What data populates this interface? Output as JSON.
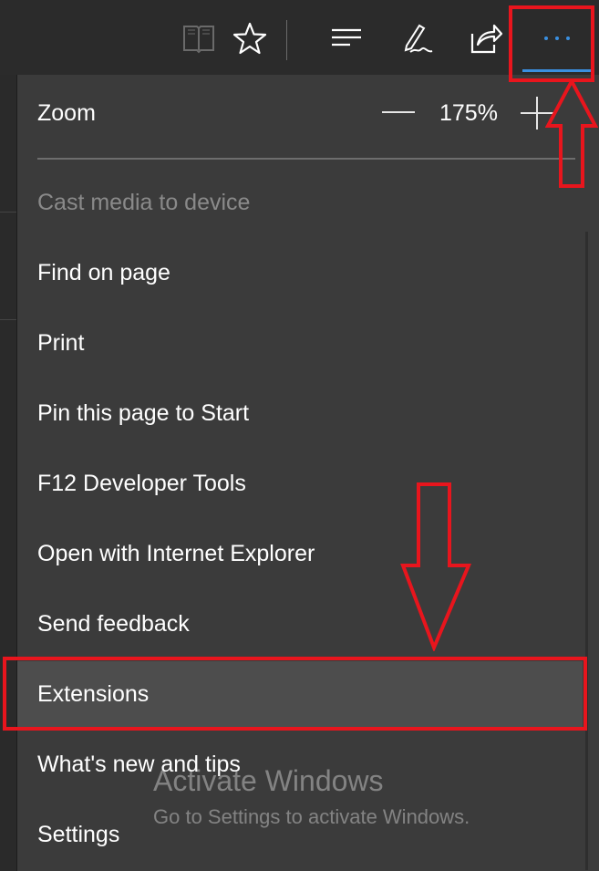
{
  "toolbar": {
    "icons": [
      "reading-view-icon",
      "favorite-star-icon",
      "hub-icon",
      "web-note-icon",
      "share-icon",
      "more-icon"
    ],
    "accent": "#3a8fe0"
  },
  "menu": {
    "zoom": {
      "label": "Zoom",
      "value": "175%"
    },
    "items": [
      {
        "label": "Cast media to device",
        "enabled": false
      },
      {
        "label": "Find on page",
        "enabled": true
      },
      {
        "label": "Print",
        "enabled": true
      },
      {
        "label": "Pin this page to Start",
        "enabled": true
      },
      {
        "label": "F12 Developer Tools",
        "enabled": true
      },
      {
        "label": "Open with Internet Explorer",
        "enabled": true
      },
      {
        "label": "Send feedback",
        "enabled": true
      },
      {
        "label": "Extensions",
        "enabled": true,
        "highlighted": true
      },
      {
        "label": "What's new and tips",
        "enabled": true
      },
      {
        "label": "Settings",
        "enabled": true
      }
    ]
  },
  "watermark": {
    "title": "Activate Windows",
    "subtitle": "Go to Settings to activate Windows."
  },
  "annotation_color": "#e8151d"
}
